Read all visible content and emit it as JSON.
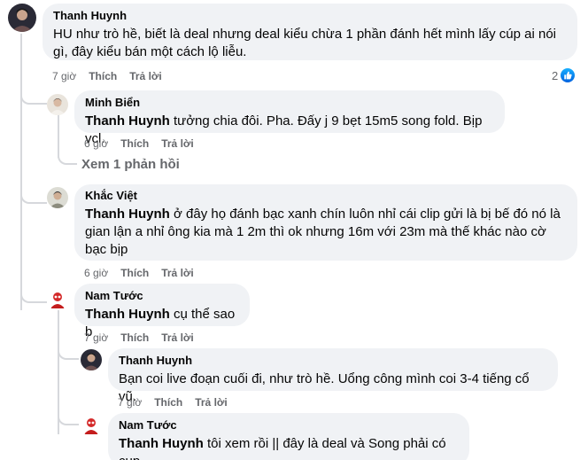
{
  "comments": [
    {
      "author": "Thanh Huynh",
      "text": "HU như trò hề, biết là deal nhưng deal kiểu chừa 1 phần đánh hết mình lấy cúp ai nói gì, đây kiểu bán một cách lộ liễu.",
      "time": "7 giờ",
      "like": "Thích",
      "reply": "Trả lời",
      "reaction_count": "2",
      "reaction_icon": "like-icon"
    },
    {
      "author": "Minh Biển",
      "mention": "Thanh Huynh",
      "text": "tưởng chia đôi. Pha. Đấy j 9 bẹt 15m5 song fold. Bịp vcl.",
      "time": "6 giờ",
      "like": "Thích",
      "reply": "Trả lời",
      "more_replies": "Xem 1 phản hồi"
    },
    {
      "author": "Khắc Việt",
      "mention": "Thanh Huynh",
      "text": "ở đây họ đánh bạc xanh chín luôn nhỉ cái clip gửi là bị bế đó nó là gian lận a nhỉ ông kia mà 1 2m thì ok nhưng 16m với 23m mà thế khác nào cờ bạc bịp",
      "time": "6 giờ",
      "like": "Thích",
      "reply": "Trả lời"
    },
    {
      "author": "Nam Tước",
      "mention": "Thanh Huynh",
      "text": "cụ thể sao b",
      "time": "7 giờ",
      "like": "Thích",
      "reply": "Trả lời"
    },
    {
      "author": "Thanh Huynh",
      "text": "Bạn coi live đoạn cuối đi, như trò hề. Uổng công mình coi 3-4 tiếng cổ vũ.",
      "time": "7 giờ",
      "like": "Thích",
      "reply": "Trả lời"
    },
    {
      "author": "Nam Tước",
      "mention": "Thanh Huynh",
      "text": "tôi xem rồi || đây là deal và Song phải có cup."
    }
  ],
  "colors": {
    "bubble": "#f0f2f5",
    "meta": "#65676b",
    "like_blue": "#0866ff",
    "thread_line": "#d6d8dc"
  }
}
